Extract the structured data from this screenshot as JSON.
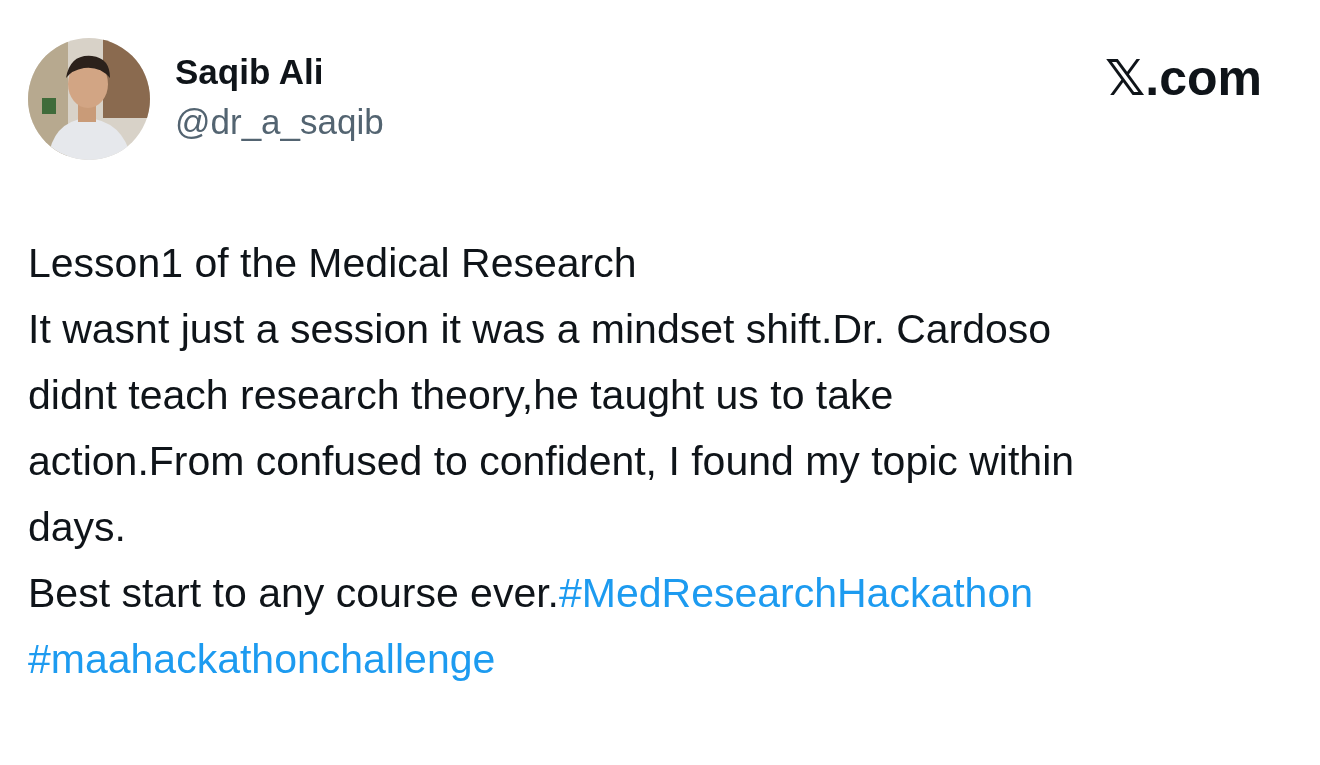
{
  "author": {
    "name": "Saqib Ali",
    "handle": "@dr_a_saqib"
  },
  "brand": {
    "mark": "𝕏",
    "text": ".com"
  },
  "body": [
    [
      {
        "kind": "text",
        "text": "Lesson1 of the Medical Research"
      }
    ],
    [
      {
        "kind": "text",
        "text": "It wasnt just a session it was a mindset shift.Dr. Cardoso"
      }
    ],
    [
      {
        "kind": "text",
        "text": "didnt teach research theory,he taught us to take"
      }
    ],
    [
      {
        "kind": "text",
        "text": "action.From confused to confident, I found my topic within"
      }
    ],
    [
      {
        "kind": "text",
        "text": "days."
      }
    ],
    [
      {
        "kind": "text",
        "text": "Best start to any course ever."
      },
      {
        "kind": "hashtag",
        "text": "#MedResearchHackathon"
      }
    ],
    [
      {
        "kind": "hashtag",
        "text": "#maahackathonchallenge"
      }
    ]
  ]
}
